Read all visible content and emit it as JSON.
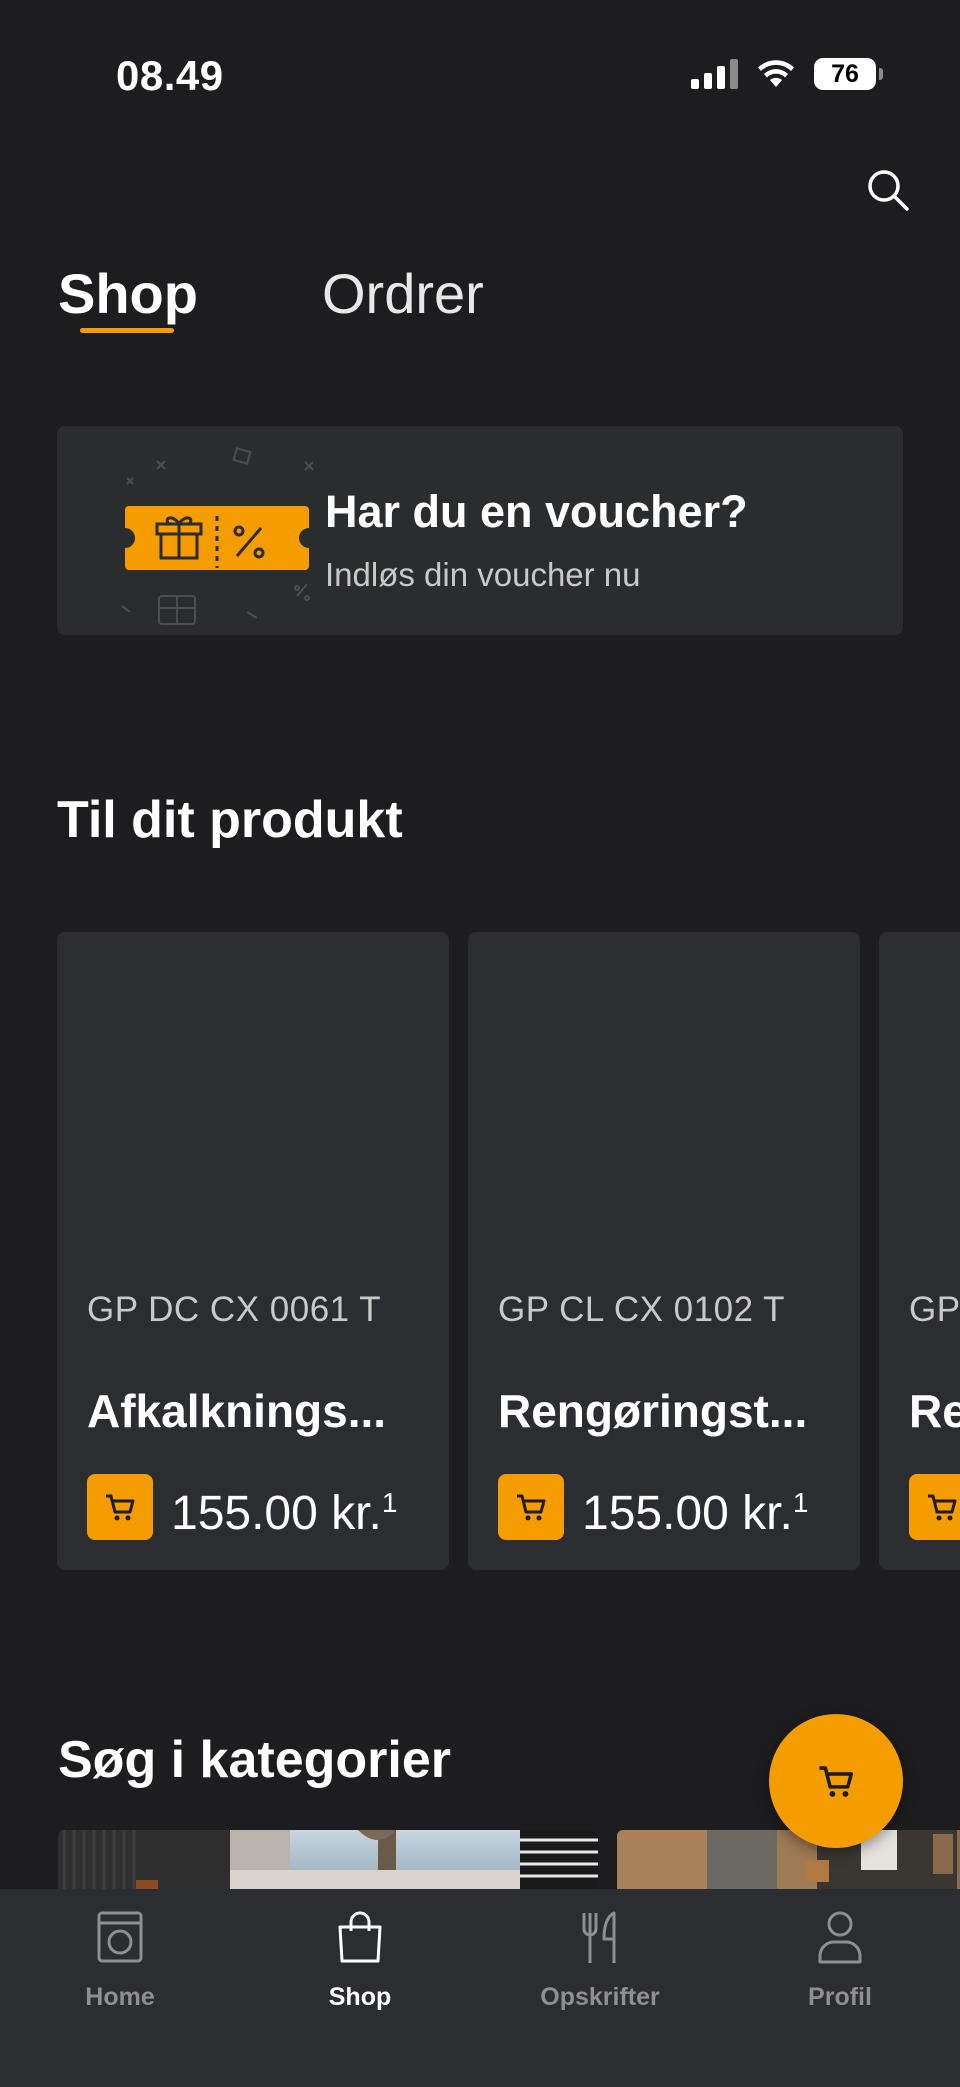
{
  "status_bar": {
    "time": "08.49",
    "battery": "76"
  },
  "header": {
    "tabs": [
      {
        "label": "Shop",
        "active": true
      },
      {
        "label": "Ordrer",
        "active": false
      }
    ]
  },
  "voucher": {
    "title": "Har du en voucher?",
    "subtitle": "Indløs din voucher nu"
  },
  "products_section": {
    "title": "Til dit produkt",
    "cards": [
      {
        "sku": "GP DC CX 0061 T",
        "name": "Afkalknings...",
        "price": "155.00 kr.",
        "footnote": "1"
      },
      {
        "sku": "GP CL CX 0102 T",
        "name": "Rengøringst...",
        "price": "155.00 kr.",
        "footnote": "1"
      },
      {
        "sku": "GP",
        "name": "Re",
        "price": "",
        "footnote": ""
      }
    ]
  },
  "categories_section": {
    "title": "Søg i kategorier"
  },
  "bottom_nav": {
    "items": [
      {
        "label": "Home",
        "icon": "washing-machine-icon",
        "active": false
      },
      {
        "label": "Shop",
        "icon": "shopping-bag-icon",
        "active": true
      },
      {
        "label": "Opskrifter",
        "icon": "fork-knife-icon",
        "active": false
      },
      {
        "label": "Profil",
        "icon": "person-icon",
        "active": false
      }
    ]
  },
  "colors": {
    "accent": "#f59c00",
    "background": "#1d1d1f",
    "card": "#2b2d30"
  }
}
